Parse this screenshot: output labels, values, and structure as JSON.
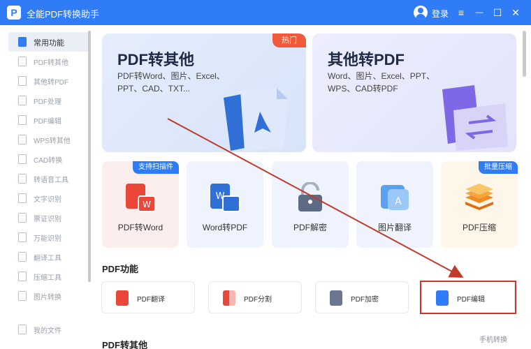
{
  "app": {
    "logo_letter": "P",
    "title": "全能PDF转换助手",
    "login_label": "登录",
    "menu_icon": "≡",
    "minimize_icon": "—",
    "maximize_icon": "☐",
    "close_icon": "✕"
  },
  "sidebar": {
    "items": [
      {
        "label": "常用功能",
        "active": true
      },
      {
        "label": "PDF转其他"
      },
      {
        "label": "其他转PDF"
      },
      {
        "label": "PDF处理"
      },
      {
        "label": "PDF编辑"
      },
      {
        "label": "WPS转其他"
      },
      {
        "label": "CAD转换"
      },
      {
        "label": "转语音工具"
      },
      {
        "label": "文字识别"
      },
      {
        "label": "票证识别"
      },
      {
        "label": "万能识别"
      },
      {
        "label": "翻译工具"
      },
      {
        "label": "压缩工具"
      },
      {
        "label": "图片转换"
      }
    ],
    "my_files": "我的文件"
  },
  "hero": {
    "left": {
      "title": "PDF转其他",
      "desc_line1": "PDF转Word、图片、Excel、",
      "desc_line2": "PPT、CAD、TXT...",
      "badge": "热门"
    },
    "right": {
      "title": "其他转PDF",
      "desc_line1": "Word、图片、Excel、PPT、",
      "desc_line2": "WPS、CAD转PDF"
    }
  },
  "tools": [
    {
      "label": "PDF转Word",
      "badge": "支持扫描件"
    },
    {
      "label": "Word转PDF"
    },
    {
      "label": "PDF解密"
    },
    {
      "label": "图片翻译"
    },
    {
      "label": "PDF压缩",
      "badge": "批量压缩"
    }
  ],
  "pdf_functions": {
    "title": "PDF功能",
    "items": [
      {
        "label": "PDF翻译"
      },
      {
        "label": "PDF分割"
      },
      {
        "label": "PDF加密"
      },
      {
        "label": "PDF编辑"
      }
    ]
  },
  "pdf_to_other": {
    "title": "PDF转其他"
  },
  "mobile_link": "手机转换",
  "colors": {
    "accent": "#2f7cf6",
    "hot": "#f05a3a",
    "annotation": "#c0392b"
  }
}
